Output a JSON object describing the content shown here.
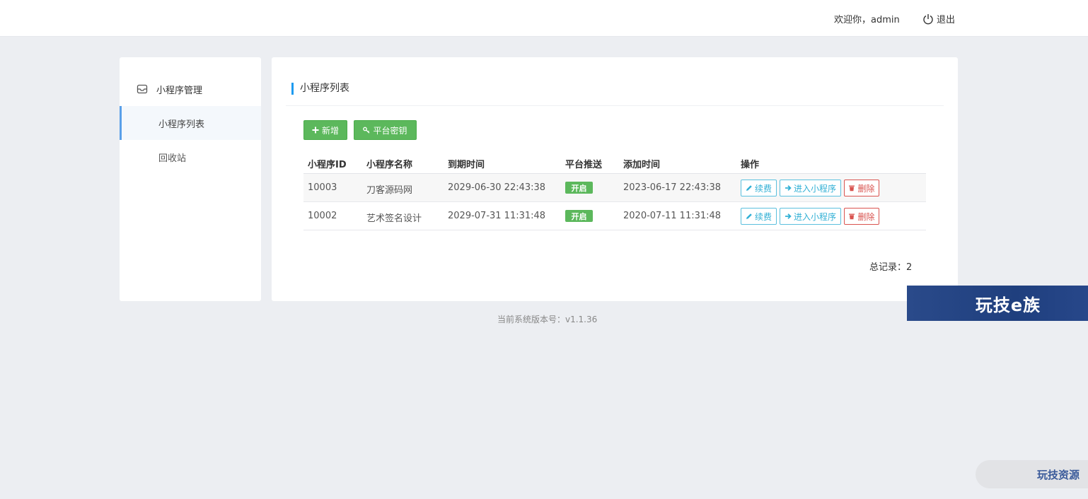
{
  "header": {
    "welcome": "欢迎你，admin",
    "logout_label": "退出"
  },
  "sidebar": {
    "group_label": "小程序管理",
    "items": [
      {
        "label": "小程序列表",
        "active": true
      },
      {
        "label": "回收站",
        "active": false
      }
    ]
  },
  "panel": {
    "title": "小程序列表",
    "add_button": "新增",
    "key_button": "平台密钥"
  },
  "table": {
    "columns": [
      "小程序ID",
      "小程序名称",
      "到期时间",
      "平台推送",
      "添加时间",
      "操作"
    ],
    "rows": [
      {
        "id": "10003",
        "name": "刀客源码网",
        "expire": "2029-06-30 22:43:38",
        "push": "开启",
        "added": "2023-06-17 22:43:38"
      },
      {
        "id": "10002",
        "name": "艺术签名设计",
        "expire": "2029-07-31 11:31:48",
        "push": "开启",
        "added": "2020-07-11 11:31:48"
      }
    ],
    "actions": {
      "renew": "续费",
      "enter": "进入小程序",
      "delete": "删除"
    }
  },
  "total_text": "总记录：2",
  "version_text": "当前系统版本号：v1.1.36",
  "watermarks": {
    "banner": "玩技e族",
    "pill": "玩技资源"
  },
  "colors": {
    "accent": "#1e9bf0",
    "green": "#5cb85c",
    "info": "#5bc0de",
    "danger": "#d9534f"
  }
}
